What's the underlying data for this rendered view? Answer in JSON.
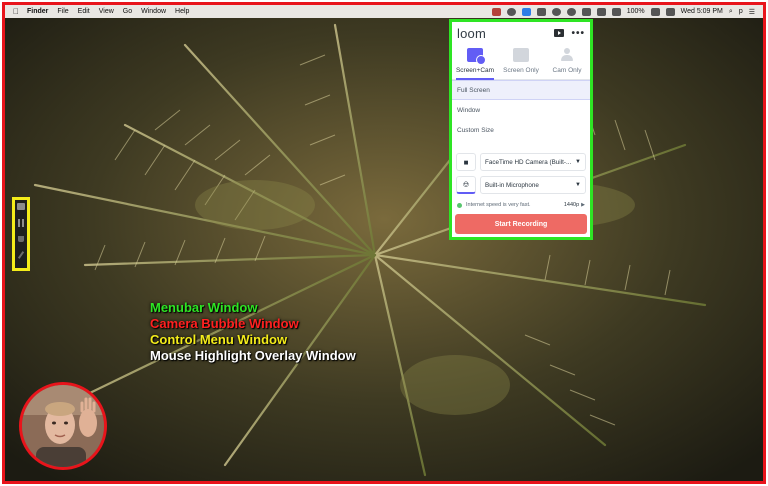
{
  "menubar": {
    "apple_icon": "apple-logo-icon",
    "app_name": "Finder",
    "items": [
      "File",
      "Edit",
      "View",
      "Go",
      "Window",
      "Help"
    ],
    "battery": "100%",
    "clock": "Wed 5:09 PM",
    "user": "p"
  },
  "loom": {
    "logo": "loom",
    "modes": [
      {
        "label": "Screen+Cam",
        "icon": "screen-cam-icon",
        "active": true
      },
      {
        "label": "Screen Only",
        "icon": "screen-only-icon",
        "active": false
      },
      {
        "label": "Cam Only",
        "icon": "cam-only-icon",
        "active": false
      }
    ],
    "options": [
      "Full Screen",
      "Window",
      "Custom Size"
    ],
    "camera": "FaceTime HD Camera (Built-...",
    "microphone": "Built-in Microphone",
    "speed_text": "Internet speed is very fast.",
    "resolution": "1440p",
    "start_label": "Start Recording",
    "accent": "#615cf5",
    "start_color": "#ee6a64"
  },
  "legend": [
    {
      "text": "Menubar Window",
      "color": "#2ee524"
    },
    {
      "text": "Camera Bubble Window",
      "color": "#ff2020"
    },
    {
      "text": "Control Menu Window",
      "color": "#f4ec1a"
    },
    {
      "text": "Mouse Highlight Overlay Window",
      "color": "#ffffff"
    }
  ],
  "outline_colors": {
    "frame": "#e8141b",
    "menubar_window": "#2ee524",
    "control_menu": "#f4ec1a",
    "camera_bubble": "#e8141b"
  }
}
